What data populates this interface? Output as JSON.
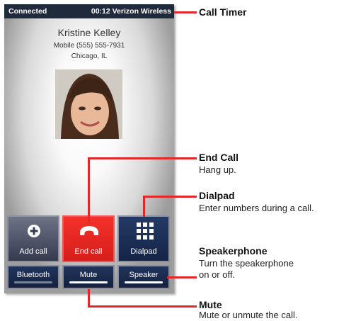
{
  "status_bar": {
    "left": "Connected",
    "right": "00:12 Verizon Wireless"
  },
  "caller": {
    "name": "Kristine Kelley",
    "number": "Mobile (555) 555-7931",
    "city": "Chicago, IL"
  },
  "buttons": {
    "add_call": "Add call",
    "end_call": "End call",
    "dialpad": "Dialpad",
    "bluetooth": "Bluetooth",
    "mute": "Mute",
    "speaker": "Speaker"
  },
  "colors": {
    "end_call": "#e8241f",
    "status_bar": "#1f2a3c",
    "callout": "#e3282b"
  },
  "callouts": {
    "call_timer": {
      "title": "Call Timer"
    },
    "end_call": {
      "title": "End Call",
      "desc": "Hang up."
    },
    "dialpad": {
      "title": "Dialpad",
      "desc": "Enter numbers during a call."
    },
    "speakerphone": {
      "title": "Speakerphone",
      "desc_line1": "Turn the speakerphone",
      "desc_line2": "on or off."
    },
    "mute": {
      "title": "Mute",
      "desc": "Mute or unmute the call."
    }
  }
}
